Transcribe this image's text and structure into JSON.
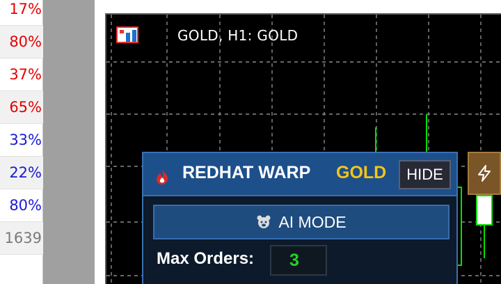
{
  "percent_list": [
    {
      "value": "17%",
      "color": "#e60000"
    },
    {
      "value": "80%",
      "color": "#e60000"
    },
    {
      "value": "37%",
      "color": "#e60000"
    },
    {
      "value": "65%",
      "color": "#e60000"
    },
    {
      "value": "33%",
      "color": "#1a1ad6"
    },
    {
      "value": "22%",
      "color": "#1a1ad6"
    },
    {
      "value": "80%",
      "color": "#1a1ad6"
    },
    {
      "value": "1639",
      "color": "#7a7a7a"
    }
  ],
  "chart": {
    "title": "GOLD, H1:  GOLD",
    "icons": [
      "grid-table-icon",
      "chart-bars-icon"
    ],
    "background": "#000000",
    "candle_color": "#00e000"
  },
  "panel": {
    "brand_name": "REDHAT WARP",
    "brand_symbol": "GOLD",
    "hide_label": "HIDE",
    "ai_mode_label": "AI MODE",
    "max_orders_label": "Max Orders:",
    "max_orders_value": "3",
    "brand_icon": "flame-icon",
    "ai_icon": "bear-icon",
    "side_icon": "lightning-icon",
    "colors": {
      "header": "#1d4f8a",
      "symbol": "#f5c518",
      "value": "#22d12a"
    }
  }
}
